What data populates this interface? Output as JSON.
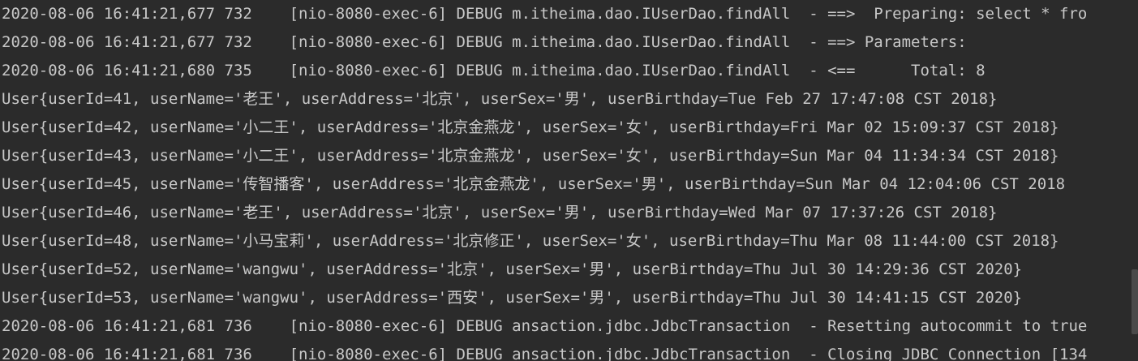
{
  "console": {
    "lines": [
      "2020-08-06 16:41:21,677 732    [nio-8080-exec-6] DEBUG m.itheima.dao.IUserDao.findAll  - ==>  Preparing: select * fro",
      "2020-08-06 16:41:21,677 732    [nio-8080-exec-6] DEBUG m.itheima.dao.IUserDao.findAll  - ==> Parameters: ",
      "2020-08-06 16:41:21,680 735    [nio-8080-exec-6] DEBUG m.itheima.dao.IUserDao.findAll  - <==      Total: 8",
      "User{userId=41, userName='老王', userAddress='北京', userSex='男', userBirthday=Tue Feb 27 17:47:08 CST 2018}",
      "User{userId=42, userName='小二王', userAddress='北京金燕龙', userSex='女', userBirthday=Fri Mar 02 15:09:37 CST 2018}",
      "User{userId=43, userName='小二王', userAddress='北京金燕龙', userSex='女', userBirthday=Sun Mar 04 11:34:34 CST 2018}",
      "User{userId=45, userName='传智播客', userAddress='北京金燕龙', userSex='男', userBirthday=Sun Mar 04 12:04:06 CST 2018",
      "User{userId=46, userName='老王', userAddress='北京', userSex='男', userBirthday=Wed Mar 07 17:37:26 CST 2018}",
      "User{userId=48, userName='小马宝莉', userAddress='北京修正', userSex='女', userBirthday=Thu Mar 08 11:44:00 CST 2018}",
      "User{userId=52, userName='wangwu', userAddress='北京', userSex='男', userBirthday=Thu Jul 30 14:29:36 CST 2020}",
      "User{userId=53, userName='wangwu', userAddress='西安', userSex='男', userBirthday=Thu Jul 30 14:41:15 CST 2020}",
      "2020-08-06 16:41:21,681 736    [nio-8080-exec-6] DEBUG ansaction.jdbc.JdbcTransaction  - Resetting autocommit to true",
      "2020-08-06 16:41:21,681 736    [nio-8080-exec-6] DEBUG ansaction.jdbc.JdbcTransaction  - Closing JDBC Connection [134"
    ]
  },
  "colors": {
    "background": "#2b2b2b",
    "text": "#c8c8c8"
  }
}
